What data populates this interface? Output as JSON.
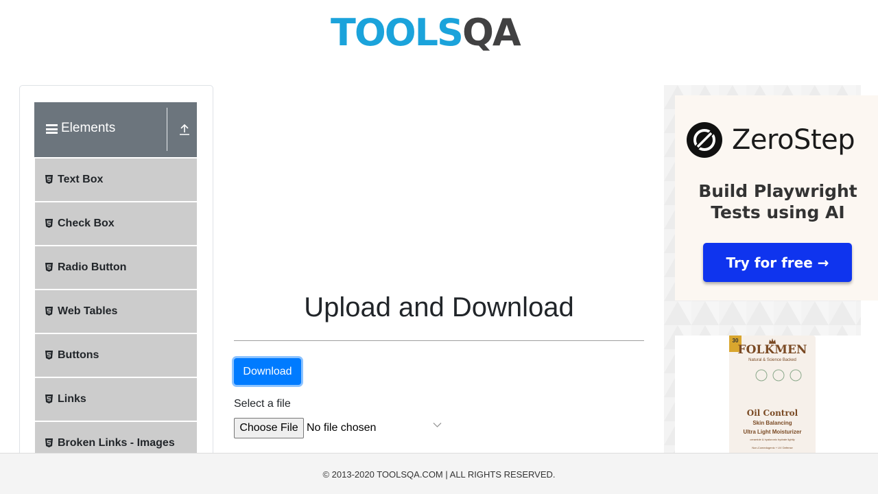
{
  "header": {
    "logo_text": "TOOLSQA",
    "logo_colors": {
      "primary": "#1ba3db",
      "secondary": "#414142"
    }
  },
  "sidebar": {
    "group_title": "Elements",
    "group_icon": "hamburger-icon",
    "collapse_icon": "upload-arrow-icon",
    "items": [
      {
        "label": "Text Box",
        "icon": "html5-icon"
      },
      {
        "label": "Check Box",
        "icon": "html5-icon"
      },
      {
        "label": "Radio Button",
        "icon": "html5-icon"
      },
      {
        "label": "Web Tables",
        "icon": "html5-icon"
      },
      {
        "label": "Buttons",
        "icon": "html5-icon"
      },
      {
        "label": "Links",
        "icon": "html5-icon"
      },
      {
        "label": "Broken Links - Images",
        "icon": "html5-icon"
      }
    ]
  },
  "main": {
    "title": "Upload and Download",
    "download_label": "Download",
    "select_label": "Select a file",
    "choose_file_label": "Choose File",
    "no_file_text": "No file chosen",
    "accent_color": "#007bff"
  },
  "ads": {
    "zerostep": {
      "brand": "ZeroStep",
      "tagline_line1": "Build Playwright",
      "tagline_line2": "Tests using AI",
      "cta": "Try for free →",
      "cta_color": "#0f34ee"
    },
    "folkmen": {
      "badge": "30",
      "brand": "FOLKMEN",
      "sub": "Natural & Science Backed",
      "product": "Oil Control",
      "line1": "Skin Balancing",
      "line2": "Ultra Light Moisturizer",
      "tiny1": "ceramide & hyaluronic hydrate lightly ",
      "tiny2": "Non-Comedogenic + UV Defense"
    }
  },
  "footer": {
    "text": "© 2013-2020 TOOLSQA.COM | ALL RIGHTS RESERVED."
  }
}
